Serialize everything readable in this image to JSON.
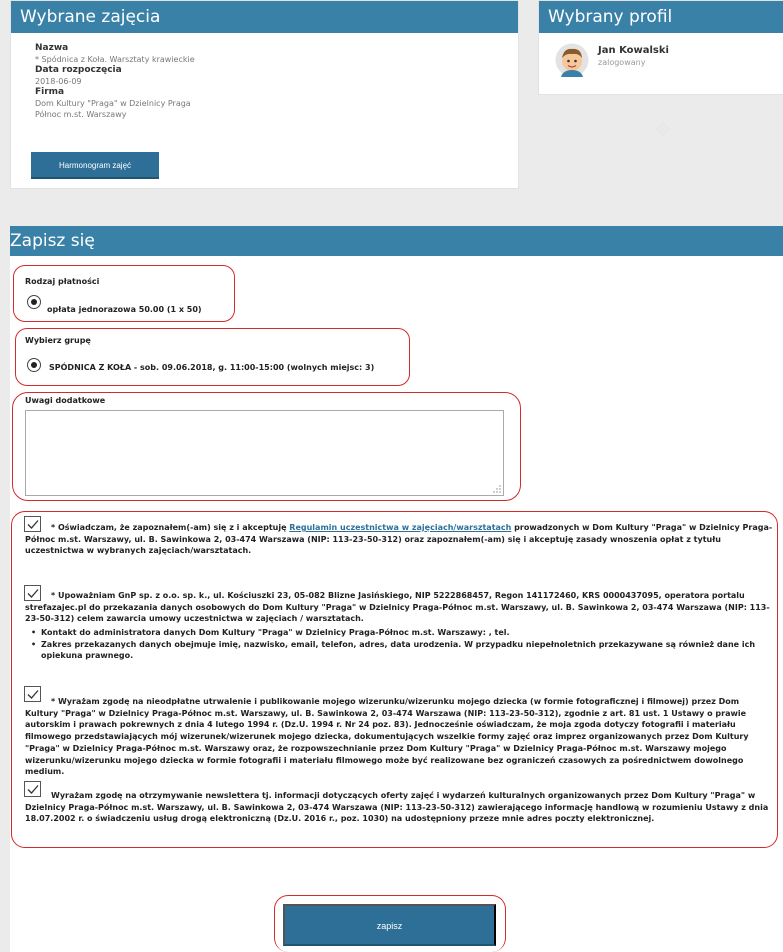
{
  "selected_class": {
    "title": "Wybrane zajęcia",
    "name_label": "Nazwa",
    "name_value": "* Spódnica z Koła. Warsztaty krawieckie",
    "start_label": "Data rozpoczęcia",
    "start_value": "2018-06-09",
    "company_label": "Firma",
    "company_value_line1": "Dom Kultury \"Praga\" w Dzielnicy Praga",
    "company_value_line2": "Północ m.st. Warszawy",
    "schedule_button": "Harmonogram zajęć"
  },
  "selected_profile": {
    "title": "Wybrany profil",
    "user_name": "Jan Kowalski",
    "user_status": "zalogowany"
  },
  "signup": {
    "title": "Zapisz się",
    "payment_label": "Rodzaj płatności",
    "payment_option": "opłata jednorazowa 50.00 (1 x 50)",
    "group_label": "Wybierz grupę",
    "group_option": "SPÓDNICA Z KOŁA - sob. 09.06.2018, g. 11:00-15:00 (wolnych miejsc: 3)",
    "notes_label": "Uwagi dodatkowe",
    "notes_value": "",
    "consent1_prefix": "* Oświadczam, że zapoznałem(-am) się z i akceptuję ",
    "consent1_link": "Regulamin uczestnictwa w zajęciach/warsztatach",
    "consent1_suffix": " prowadzonych w Dom Kultury \"Praga\" w Dzielnicy Praga-Północ m.st. Warszawy, ul. B. Sawinkowa 2, 03-474 Warszawa (NIP: 113-23-50-312) oraz zapoznałem(-am) się i akceptuję zasady wnoszenia opłat z tytułu uczestnictwa w wybranych zajęciach/warsztatach.",
    "consent2_text": "* Upoważniam GnP sp. z o.o. sp. k., ul. Kościuszki 23, 05-082 Blizne Jasińskiego, NIP 5222868457, Regon 141172460, KRS 0000437095, operatora portalu strefazajec.pl do przekazania danych osobowych do Dom Kultury \"Praga\" w Dzielnicy Praga-Północ m.st. Warszawy, ul. B. Sawinkowa 2, 03-474 Warszawa (NIP: 113-23-50-312) celem zawarcia umowy uczestnictwa w zajęciach / warsztatach.",
    "consent2_bullet1": "Kontakt do administratora danych Dom Kultury \"Praga\" w Dzielnicy Praga-Północ m.st. Warszawy: , tel.",
    "consent2_bullet2": "Zakres przekazanych danych obejmuje imię, nazwisko, email, telefon, adres, data urodzenia. W przypadku niepełnoletnich przekazywane są również dane ich opiekuna prawnego.",
    "consent3_text": "* Wyrażam zgodę na nieodpłatne utrwalenie i publikowanie mojego wizerunku/wizerunku mojego dziecka (w formie fotograficznej i filmowej) przez Dom Kultury \"Praga\" w Dzielnicy Praga-Północ m.st. Warszawy, ul. B. Sawinkowa 2, 03-474 Warszawa (NIP: 113-23-50-312), zgodnie z art. 81 ust. 1 Ustawy o prawie autorskim i prawach pokrewnych z dnia 4 lutego 1994 r. (Dz.U. 1994 r. Nr 24 poz. 83). Jednocześnie oświadczam, że moja zgoda dotyczy fotografii i materiału filmowego przedstawiających mój wizerunek/wizerunek mojego dziecka, dokumentujących wszelkie formy zajęć oraz imprez organizowanych przez Dom Kultury \"Praga\" w Dzielnicy Praga-Północ m.st. Warszawy oraz, że rozpowszechnianie przez Dom Kultury \"Praga\" w Dzielnicy Praga-Północ m.st. Warszawy mojego wizerunku/wizerunku mojego dziecka w formie fotografii i materiału filmowego może być realizowane bez ograniczeń czasowych za pośrednictwem dowolnego medium.",
    "consent4_text": "Wyrażam zgodę na otrzymywanie newslettera tj. informacji dotyczących oferty zajęć i wydarzeń kulturalnych organizowanych przez Dom Kultury \"Praga\" w Dzielnicy Praga-Północ m.st. Warszawy, ul. B. Sawinkowa 2, 03-474 Warszawa (NIP: 113-23-50-312) zawierającego informację handlową w rozumieniu Ustawy z dnia 18.07.2002 r. o świadczeniu usług drogą elektroniczną (Dz.U. 2016 r., poz. 1030) na udostępniony przeze mnie adres poczty elektronicznej.",
    "submit_button": "zapisz"
  },
  "colors": {
    "header_blue": "#3a81a8",
    "button_blue": "#2d6f96",
    "highlight_red": "#d22b2b"
  }
}
